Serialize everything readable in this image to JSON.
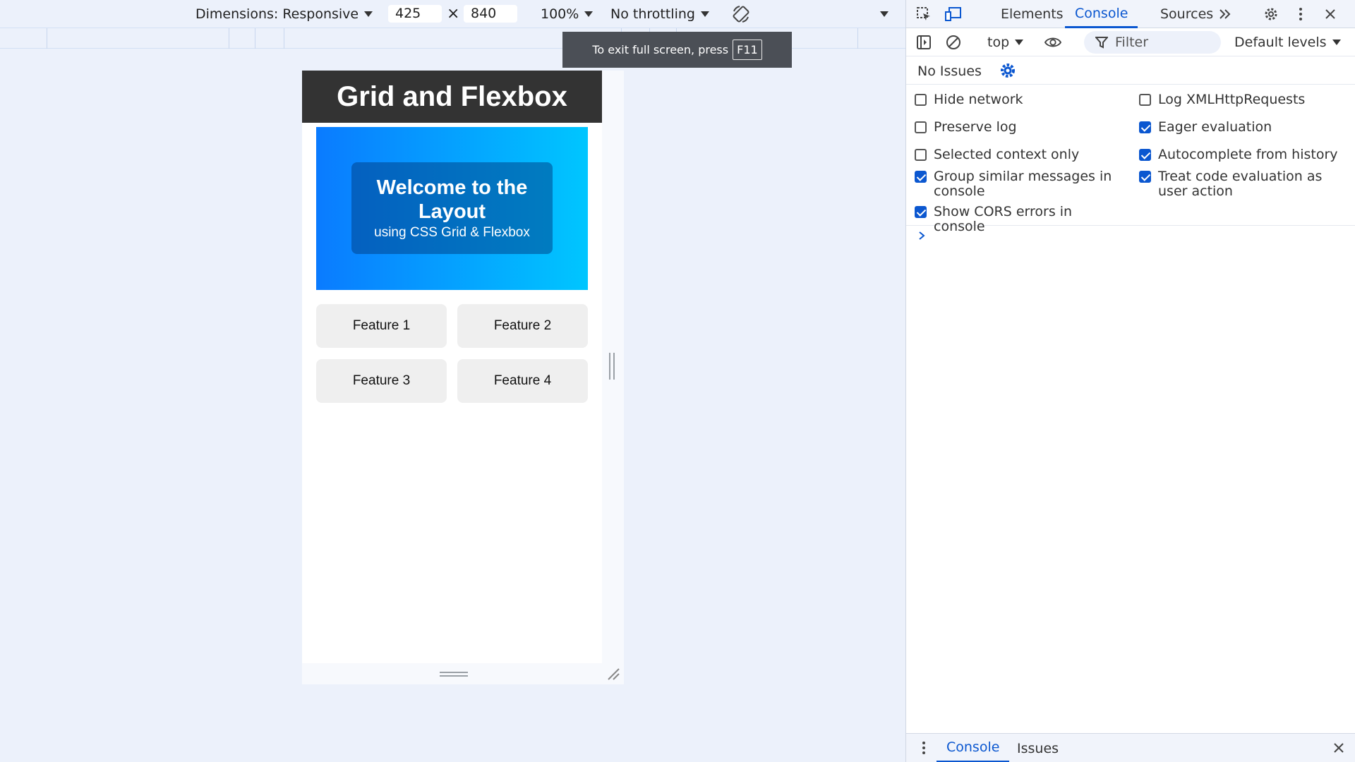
{
  "emulation_toolbar": {
    "dimensions_label": "Dimensions: Responsive",
    "width_value": "425",
    "times_symbol": "×",
    "height_value": "840",
    "zoom": "100%",
    "throttling": "No throttling"
  },
  "fullscreen_toast": {
    "message": "To exit full screen, press",
    "key": "F11"
  },
  "page": {
    "header_title": "Grid and Flexbox",
    "hero_title": "Welcome to the Layout",
    "hero_subtitle": "using CSS Grid & Flexbox",
    "features": [
      "Feature 1",
      "Feature 2",
      "Feature 3",
      "Feature 4"
    ],
    "hero_gradient": [
      "#0a7bff",
      "#00c6ff"
    ],
    "header_color": "#333333"
  },
  "devtools": {
    "tabs": [
      "Elements",
      "Console",
      "Sources"
    ],
    "active_tab": "Console",
    "context": "top",
    "filter_placeholder": "Filter",
    "levels": "Default levels",
    "issues_text": "No Issues",
    "settings": [
      {
        "label": "Hide network",
        "checked": false
      },
      {
        "label": "Log XMLHttpRequests",
        "checked": false
      },
      {
        "label": "Preserve log",
        "checked": false
      },
      {
        "label": "Eager evaluation",
        "checked": true
      },
      {
        "label": "Selected context only",
        "checked": false
      },
      {
        "label": "Autocomplete from history",
        "checked": true
      },
      {
        "label": "Group similar messages in console",
        "checked": true
      },
      {
        "label": "Treat code evaluation as user action",
        "checked": true
      },
      {
        "label": "Show CORS errors in console",
        "checked": true
      }
    ],
    "drawer_tabs": [
      "Console",
      "Issues"
    ],
    "accent_color": "#0b57d0"
  }
}
